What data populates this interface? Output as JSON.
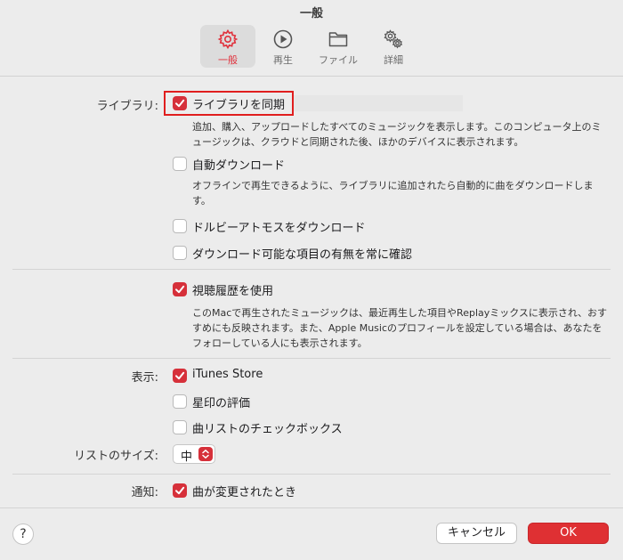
{
  "window": {
    "title": "一般"
  },
  "tabs": [
    {
      "label": "一般",
      "icon": "gear-icon",
      "active": true
    },
    {
      "label": "再生",
      "icon": "play-circle-icon",
      "active": false
    },
    {
      "label": "ファイル",
      "icon": "folder-icon",
      "active": false
    },
    {
      "label": "詳細",
      "icon": "gears-icon",
      "active": false
    }
  ],
  "library": {
    "label": "ライブラリ:",
    "sync": {
      "label": "ライブラリを同期",
      "checked": true,
      "description": "追加、購入、アップロードしたすべてのミュージックを表示します。このコンピュータ上のミュージックは、クラウドと同期された後、ほかのデバイスに表示されます。"
    },
    "auto_download": {
      "label": "自動ダウンロード",
      "checked": false,
      "description": "オフラインで再生できるように、ライブラリに追加されたら自動的に曲をダウンロードします。"
    },
    "dolby_download": {
      "label": "ドルビーアトモスをダウンロード",
      "checked": false
    },
    "always_check": {
      "label": "ダウンロード可能な項目の有無を常に確認",
      "checked": false
    }
  },
  "history": {
    "label": "視聴履歴を使用",
    "checked": true,
    "description": "このMacで再生されたミュージックは、最近再生した項目やReplayミックスに表示され、おすすめにも反映されます。また、Apple Musicのプロフィールを設定している場合は、あなたをフォローしている人にも表示されます。"
  },
  "display": {
    "label": "表示:",
    "itunes_store": {
      "label": "iTunes Store",
      "checked": true
    },
    "star_ratings": {
      "label": "星印の評価",
      "checked": false
    },
    "song_checkboxes": {
      "label": "曲リストのチェックボックス",
      "checked": false
    }
  },
  "list_size": {
    "label": "リストのサイズ:",
    "value": "中"
  },
  "notifications": {
    "label": "通知:",
    "song_changes": {
      "label": "曲が変更されたとき",
      "checked": true
    }
  },
  "buttons": {
    "help": "?",
    "cancel": "キャンセル",
    "ok": "OK"
  },
  "colors": {
    "accent": "#d6303a",
    "highlight_border": "#e01e1e"
  }
}
